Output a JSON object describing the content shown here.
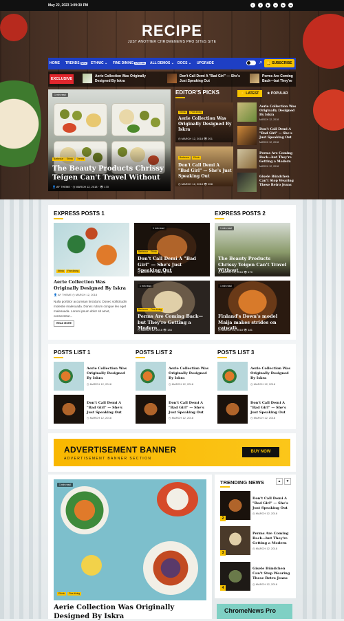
{
  "topbar": {
    "date": "May 22, 2023 1:09:30 PM",
    "social": [
      "facebook-icon",
      "twitter-icon",
      "youtube-icon",
      "vk-icon",
      "linkedin-icon",
      "whatsapp-icon"
    ]
  },
  "site": {
    "title": "RECIPE",
    "tagline": "JUST ANOTHER CHROMENEWS PRO SITES SITE"
  },
  "nav": {
    "items": [
      {
        "label": "HOME"
      },
      {
        "label": "TRENDS",
        "badge": "NEW"
      },
      {
        "label": "ETHNIC ⌄"
      },
      {
        "label": "FINE DINING",
        "badge": "SPECIAL"
      },
      {
        "label": "ALL DEMOS ⌄"
      },
      {
        "label": "DOCS ⌄"
      },
      {
        "label": "UPGRADE"
      }
    ],
    "subscribe": "SUBSCRIBE"
  },
  "ticker": {
    "label": "EXCLUSIVE",
    "items": [
      "Aerie Collection Was Originally Designed By Iskra",
      "Don't Call Demi A \"Bad Girl\" — She's Just Speaking Out",
      "Perms Are Coming Back—but They're Getting a Modern"
    ]
  },
  "hero": {
    "read": "1 min read",
    "cats": [
      "Barbecue",
      "Ethnic",
      "Trends"
    ],
    "title": "The Beauty Products Chrissy Teigen Can't Travel Without",
    "author": "AF THEME",
    "date": "MARCH 12, 2018",
    "views": "170"
  },
  "editors": {
    "heading": "EDITOR'S PICKS",
    "items": [
      {
        "read": "1 min read",
        "cats": [
          "Ethnic",
          "Fine dining"
        ],
        "title": "Aerie Collection Was Originally Designed By Iskra",
        "date": "MARCH 12, 2018",
        "views": "201"
      },
      {
        "read": "1 min read",
        "cats": [
          "Barbecue",
          "Fine dining"
        ],
        "title": "Perms Are Coming Back—but They're Getting a Modern",
        "date": "MARCH 12, 2018",
        "views": "185"
      },
      {
        "read": "1 min read",
        "cats": [
          "Barbecue",
          "Ethnic"
        ],
        "title": "Don't Call Demi A \"Bad Girl\" — She's Just Speaking Out",
        "date": "MARCH 12, 2018",
        "views": "208"
      },
      {
        "read": "1 min read",
        "cats": [
          "Barbecue",
          "Ethnic"
        ],
        "title": "Finland's Down's model Maija makes strides on catwalk",
        "date": "MARCH 12, 2018",
        "views": "181"
      }
    ]
  },
  "latest": {
    "tabs": [
      "LATEST",
      "POPULAR"
    ],
    "items": [
      {
        "title": "Aerie Collection Was Originally Designed By Iskra",
        "date": "MARCH 12, 2018"
      },
      {
        "title": "Don't Call Demi A \"Bad Girl\" — She's Just Speaking Out",
        "date": "MARCH 12, 2018"
      },
      {
        "title": "Perms Are Coming Back—but They're Getting a Modern",
        "date": "MARCH 12, 2018"
      },
      {
        "title": "Gisele Bündchen Can't Stop Wearing These Retro Jeans",
        "date": "MARCH 12, 2018"
      }
    ]
  },
  "express1": {
    "heading": "EXPRESS POSTS 1",
    "main": {
      "cats": [
        "Ethnic",
        "Fine dining"
      ],
      "title": "Aerie Collection Was Originally Designed By Iskra",
      "author": "AF THEME",
      "date": "MARCH 12, 2018",
      "excerpt": "Nulla porttitor accumsan tincidunt. Donec sollicitudin molestie malesuada. Donec rutrum congue leo eget malesuada. Lorem ipsum dolor sit amet, consectetur...",
      "read_more": "READ MORE"
    },
    "cards": [
      {
        "read": "1 min read",
        "cats": [
          "Barbecue",
          "Ethnic"
        ],
        "title": "Don't Call Demi A \"Bad Girl\" — She's Just Speaking Out",
        "date": "MARCH 12, 2018",
        "views": "208"
      },
      {
        "read": "1 min read",
        "cats": [
          "Barbecue",
          "Fine dining"
        ],
        "title": "Perms Are Coming Back—but They're Getting a Modern",
        "date": "MARCH 12, 2018",
        "views": "184"
      }
    ]
  },
  "express2": {
    "heading": "EXPRESS POSTS 2",
    "cards": [
      {
        "read": "1 min read",
        "title": "The Beauty Products Chrissy Teigen Can't Travel Without",
        "date": "MARCH 12, 2018",
        "views": "170"
      },
      {
        "read": "1 min read",
        "title": "Finland's Down's model Maija makes strides on catwalk",
        "date": "MARCH 12, 2018",
        "views": "181"
      }
    ]
  },
  "lists": [
    {
      "heading": "POSTS LIST 1",
      "items": [
        {
          "title": "Aerie Collection Was Originally Designed By Iskra",
          "date": "MARCH 12, 2018"
        },
        {
          "title": "Don't Call Demi A \"Bad Girl\" — She's Just Speaking Out",
          "date": "MARCH 12, 2018"
        }
      ]
    },
    {
      "heading": "POSTS LIST 2",
      "items": [
        {
          "title": "Aerie Collection Was Originally Designed By Iskra",
          "date": "MARCH 12, 2018"
        },
        {
          "title": "Don't Call Demi A \"Bad Girl\" — She's Just Speaking Out",
          "date": "MARCH 12, 2018"
        }
      ]
    },
    {
      "heading": "POSTS LIST 3",
      "items": [
        {
          "title": "Aerie Collection Was Originally Designed By Iskra",
          "date": "MARCH 12, 2018"
        },
        {
          "title": "Don't Call Demi A \"Bad Girl\" — She's Just Speaking Out",
          "date": "MARCH 12, 2018"
        }
      ]
    }
  ],
  "ad": {
    "title": "ADVERTISEMENT BANNER",
    "subtitle": "ADVERTISEMENT BANNER SECTION",
    "button": "BUY NOW"
  },
  "featured": {
    "read": "1 min read",
    "cats": [
      "Ethnic",
      "Fine dining"
    ],
    "title": "Aerie Collection Was Originally Designed By Iskra"
  },
  "trending": {
    "heading": "TRENDING NEWS",
    "items": [
      {
        "num": "2",
        "title": "Don't Call Demi A \"Bad Girl\" — She's Just Speaking Out",
        "date": "MARCH 12, 2018"
      },
      {
        "num": "3",
        "title": "Perms Are Coming Back—but They're Getting a Modern",
        "date": "MARCH 12, 2018"
      },
      {
        "num": "4",
        "title": "Gisele Bündchen Can't Stop Wearing These Retro Jeans",
        "date": "MARCH 12, 2018"
      }
    ]
  },
  "promo": {
    "title": "ChromeNews Pro"
  }
}
